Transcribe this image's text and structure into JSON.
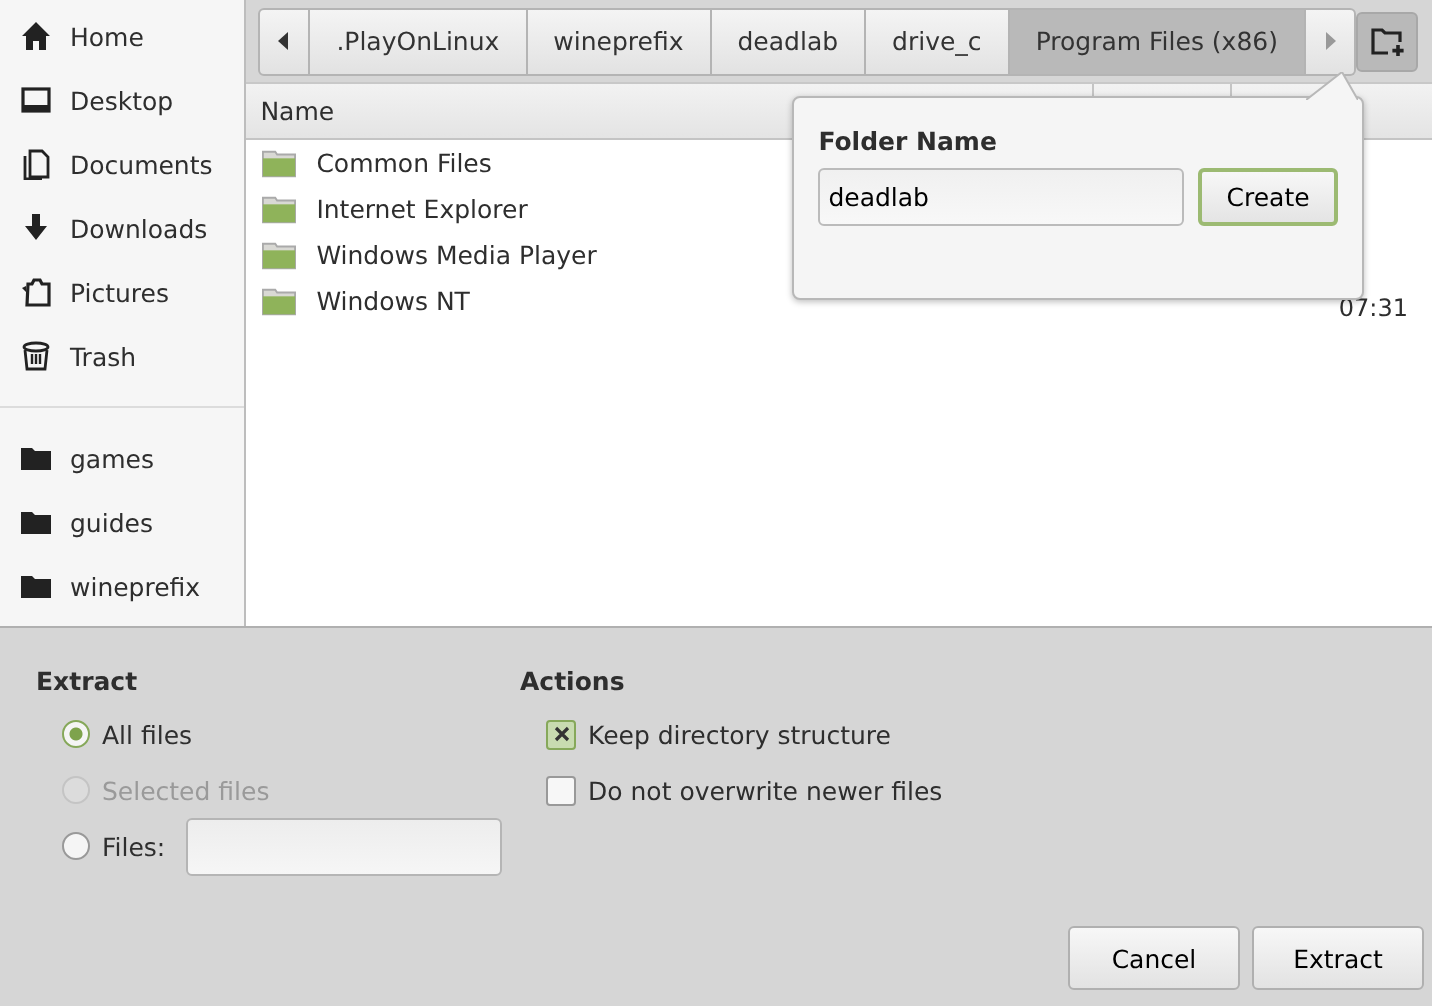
{
  "sidebar": {
    "places": [
      {
        "label": "Home",
        "selected": false
      },
      {
        "label": "Desktop",
        "selected": false
      },
      {
        "label": "Documents",
        "selected": false
      },
      {
        "label": "Downloads",
        "selected": false
      },
      {
        "label": "Pictures",
        "selected": false
      },
      {
        "label": "Trash",
        "selected": false
      }
    ],
    "bookmarks": [
      {
        "label": "games",
        "selected": false
      },
      {
        "label": "guides",
        "selected": false
      },
      {
        "label": "wineprefix",
        "selected": false
      }
    ]
  },
  "path_bar": [
    {
      "label": ".PlayOnLinux",
      "selected": false
    },
    {
      "label": "wineprefix",
      "selected": false
    },
    {
      "label": "deadlab",
      "selected": false
    },
    {
      "label": "drive_c",
      "selected": false
    },
    {
      "label": "Program Files (x86)",
      "selected": true
    }
  ],
  "table": {
    "columns": [
      "Name"
    ],
    "rows": [
      {
        "name": "Common Files"
      },
      {
        "name": "Internet Explorer"
      },
      {
        "name": "Windows Media Player"
      },
      {
        "name": "Windows NT",
        "time": "07:31"
      }
    ]
  },
  "popover": {
    "title": "Folder Name",
    "value": "deadlab",
    "button": "Create"
  },
  "extract": {
    "title": "Extract",
    "options": [
      {
        "label": "All files",
        "selected": true,
        "disabled": false
      },
      {
        "label": "Selected files",
        "selected": false,
        "disabled": true
      },
      {
        "label": "Files:",
        "selected": false,
        "disabled": false,
        "kind": "field"
      }
    ]
  },
  "actions": {
    "title": "Actions",
    "options": [
      {
        "label": "Keep directory structure",
        "checked": true
      },
      {
        "label": "Do not overwrite newer files",
        "checked": false
      }
    ]
  },
  "buttons": [
    "Cancel",
    "Extract"
  ]
}
